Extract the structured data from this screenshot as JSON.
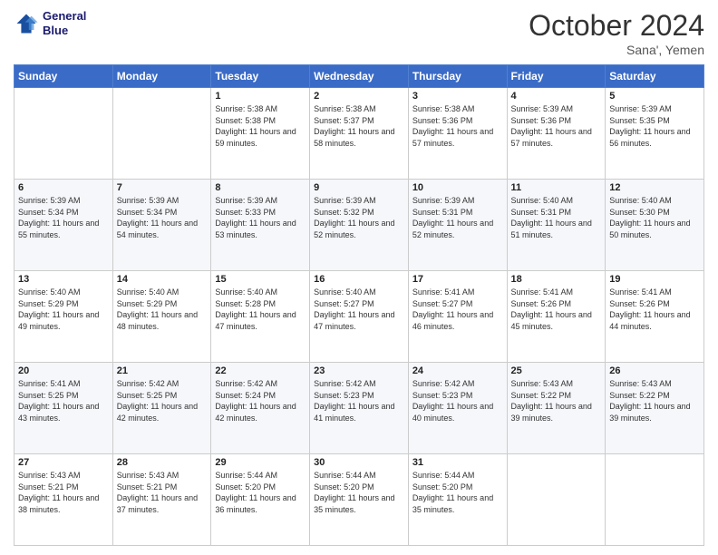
{
  "header": {
    "logo_line1": "General",
    "logo_line2": "Blue",
    "month": "October 2024",
    "location": "Sana', Yemen"
  },
  "days_of_week": [
    "Sunday",
    "Monday",
    "Tuesday",
    "Wednesday",
    "Thursday",
    "Friday",
    "Saturday"
  ],
  "weeks": [
    [
      {
        "day": "",
        "content": ""
      },
      {
        "day": "",
        "content": ""
      },
      {
        "day": "1",
        "content": "Sunrise: 5:38 AM\nSunset: 5:38 PM\nDaylight: 11 hours and 59 minutes."
      },
      {
        "day": "2",
        "content": "Sunrise: 5:38 AM\nSunset: 5:37 PM\nDaylight: 11 hours and 58 minutes."
      },
      {
        "day": "3",
        "content": "Sunrise: 5:38 AM\nSunset: 5:36 PM\nDaylight: 11 hours and 57 minutes."
      },
      {
        "day": "4",
        "content": "Sunrise: 5:39 AM\nSunset: 5:36 PM\nDaylight: 11 hours and 57 minutes."
      },
      {
        "day": "5",
        "content": "Sunrise: 5:39 AM\nSunset: 5:35 PM\nDaylight: 11 hours and 56 minutes."
      }
    ],
    [
      {
        "day": "6",
        "content": "Sunrise: 5:39 AM\nSunset: 5:34 PM\nDaylight: 11 hours and 55 minutes."
      },
      {
        "day": "7",
        "content": "Sunrise: 5:39 AM\nSunset: 5:34 PM\nDaylight: 11 hours and 54 minutes."
      },
      {
        "day": "8",
        "content": "Sunrise: 5:39 AM\nSunset: 5:33 PM\nDaylight: 11 hours and 53 minutes."
      },
      {
        "day": "9",
        "content": "Sunrise: 5:39 AM\nSunset: 5:32 PM\nDaylight: 11 hours and 52 minutes."
      },
      {
        "day": "10",
        "content": "Sunrise: 5:39 AM\nSunset: 5:31 PM\nDaylight: 11 hours and 52 minutes."
      },
      {
        "day": "11",
        "content": "Sunrise: 5:40 AM\nSunset: 5:31 PM\nDaylight: 11 hours and 51 minutes."
      },
      {
        "day": "12",
        "content": "Sunrise: 5:40 AM\nSunset: 5:30 PM\nDaylight: 11 hours and 50 minutes."
      }
    ],
    [
      {
        "day": "13",
        "content": "Sunrise: 5:40 AM\nSunset: 5:29 PM\nDaylight: 11 hours and 49 minutes."
      },
      {
        "day": "14",
        "content": "Sunrise: 5:40 AM\nSunset: 5:29 PM\nDaylight: 11 hours and 48 minutes."
      },
      {
        "day": "15",
        "content": "Sunrise: 5:40 AM\nSunset: 5:28 PM\nDaylight: 11 hours and 47 minutes."
      },
      {
        "day": "16",
        "content": "Sunrise: 5:40 AM\nSunset: 5:27 PM\nDaylight: 11 hours and 47 minutes."
      },
      {
        "day": "17",
        "content": "Sunrise: 5:41 AM\nSunset: 5:27 PM\nDaylight: 11 hours and 46 minutes."
      },
      {
        "day": "18",
        "content": "Sunrise: 5:41 AM\nSunset: 5:26 PM\nDaylight: 11 hours and 45 minutes."
      },
      {
        "day": "19",
        "content": "Sunrise: 5:41 AM\nSunset: 5:26 PM\nDaylight: 11 hours and 44 minutes."
      }
    ],
    [
      {
        "day": "20",
        "content": "Sunrise: 5:41 AM\nSunset: 5:25 PM\nDaylight: 11 hours and 43 minutes."
      },
      {
        "day": "21",
        "content": "Sunrise: 5:42 AM\nSunset: 5:25 PM\nDaylight: 11 hours and 42 minutes."
      },
      {
        "day": "22",
        "content": "Sunrise: 5:42 AM\nSunset: 5:24 PM\nDaylight: 11 hours and 42 minutes."
      },
      {
        "day": "23",
        "content": "Sunrise: 5:42 AM\nSunset: 5:23 PM\nDaylight: 11 hours and 41 minutes."
      },
      {
        "day": "24",
        "content": "Sunrise: 5:42 AM\nSunset: 5:23 PM\nDaylight: 11 hours and 40 minutes."
      },
      {
        "day": "25",
        "content": "Sunrise: 5:43 AM\nSunset: 5:22 PM\nDaylight: 11 hours and 39 minutes."
      },
      {
        "day": "26",
        "content": "Sunrise: 5:43 AM\nSunset: 5:22 PM\nDaylight: 11 hours and 39 minutes."
      }
    ],
    [
      {
        "day": "27",
        "content": "Sunrise: 5:43 AM\nSunset: 5:21 PM\nDaylight: 11 hours and 38 minutes."
      },
      {
        "day": "28",
        "content": "Sunrise: 5:43 AM\nSunset: 5:21 PM\nDaylight: 11 hours and 37 minutes."
      },
      {
        "day": "29",
        "content": "Sunrise: 5:44 AM\nSunset: 5:20 PM\nDaylight: 11 hours and 36 minutes."
      },
      {
        "day": "30",
        "content": "Sunrise: 5:44 AM\nSunset: 5:20 PM\nDaylight: 11 hours and 35 minutes."
      },
      {
        "day": "31",
        "content": "Sunrise: 5:44 AM\nSunset: 5:20 PM\nDaylight: 11 hours and 35 minutes."
      },
      {
        "day": "",
        "content": ""
      },
      {
        "day": "",
        "content": ""
      }
    ]
  ]
}
